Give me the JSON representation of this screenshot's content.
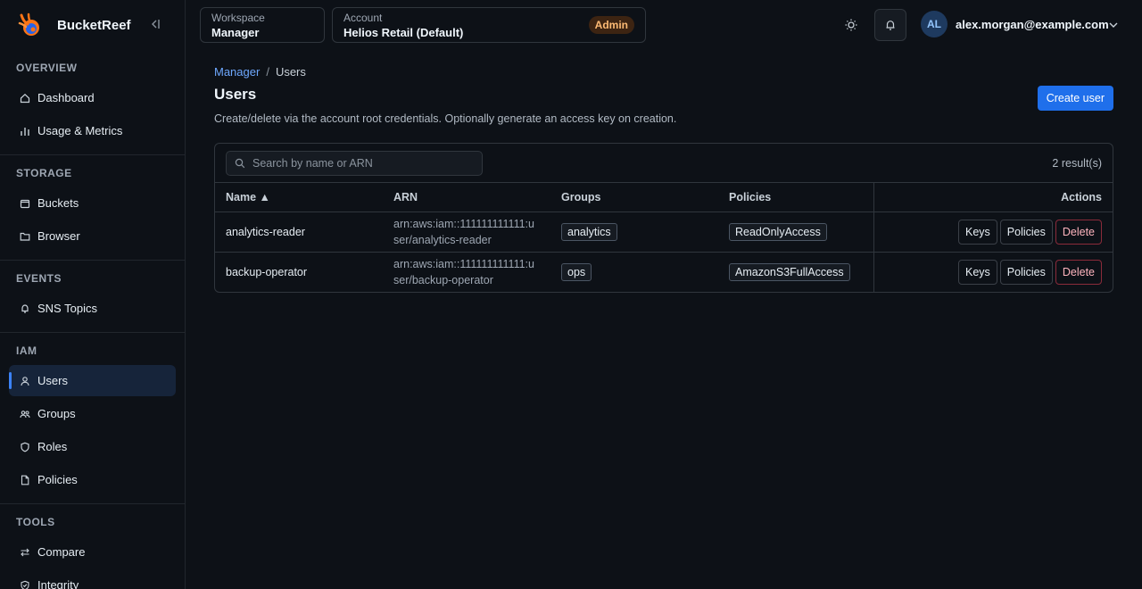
{
  "app": {
    "name": "BucketReef"
  },
  "sidebar": {
    "sections": [
      {
        "title": "OVERVIEW",
        "items": [
          {
            "label": "Dashboard",
            "icon": "home-icon"
          },
          {
            "label": "Usage & Metrics",
            "icon": "bar-chart-icon"
          }
        ]
      },
      {
        "title": "STORAGE",
        "items": [
          {
            "label": "Buckets",
            "icon": "bucket-icon"
          },
          {
            "label": "Browser",
            "icon": "folder-icon"
          }
        ]
      },
      {
        "title": "EVENTS",
        "items": [
          {
            "label": "SNS Topics",
            "icon": "bell-icon"
          }
        ]
      },
      {
        "title": "IAM",
        "items": [
          {
            "label": "Users",
            "icon": "user-icon",
            "active": true
          },
          {
            "label": "Groups",
            "icon": "users-icon"
          },
          {
            "label": "Roles",
            "icon": "shield-icon"
          },
          {
            "label": "Policies",
            "icon": "file-icon"
          }
        ]
      },
      {
        "title": "TOOLS",
        "items": [
          {
            "label": "Compare",
            "icon": "compare-icon"
          },
          {
            "label": "Integrity",
            "icon": "shield-check-icon"
          }
        ]
      }
    ]
  },
  "topbar": {
    "workspace_label": "Workspace",
    "workspace_value": "Manager",
    "account_label": "Account",
    "account_value": "Helios Retail (Default)",
    "role_badge": "Admin",
    "user_initials": "AL",
    "user_email": "alex.morgan@example.com"
  },
  "breadcrumb": {
    "parent": "Manager",
    "separator": "/",
    "current": "Users"
  },
  "page": {
    "title": "Users",
    "description": "Create/delete via the account root credentials. Optionally generate an access key on creation.",
    "create_button": "Create user"
  },
  "search": {
    "placeholder": "Search by name or ARN",
    "value": ""
  },
  "results": {
    "count_text": "2 result(s)"
  },
  "table": {
    "headers": {
      "name": "Name ▲",
      "arn": "ARN",
      "groups": "Groups",
      "policies": "Policies",
      "actions": "Actions"
    },
    "rows": [
      {
        "name": "analytics-reader",
        "arn": "arn:aws:iam::111111111111:user/analytics-reader",
        "group": "analytics",
        "policy": "ReadOnlyAccess",
        "actions": {
          "keys": "Keys",
          "policies": "Policies",
          "delete": "Delete"
        }
      },
      {
        "name": "backup-operator",
        "arn": "arn:aws:iam::111111111111:user/backup-operator",
        "group": "ops",
        "policy": "AmazonS3FullAccess",
        "actions": {
          "keys": "Keys",
          "policies": "Policies",
          "delete": "Delete"
        }
      }
    ]
  },
  "colors": {
    "background": "#0d1117",
    "accent": "#1f6feb",
    "link": "#6ea8fe",
    "admin_badge_bg": "#3d2412",
    "admin_badge_text": "#fdba74",
    "danger": "#8b2b3a"
  }
}
